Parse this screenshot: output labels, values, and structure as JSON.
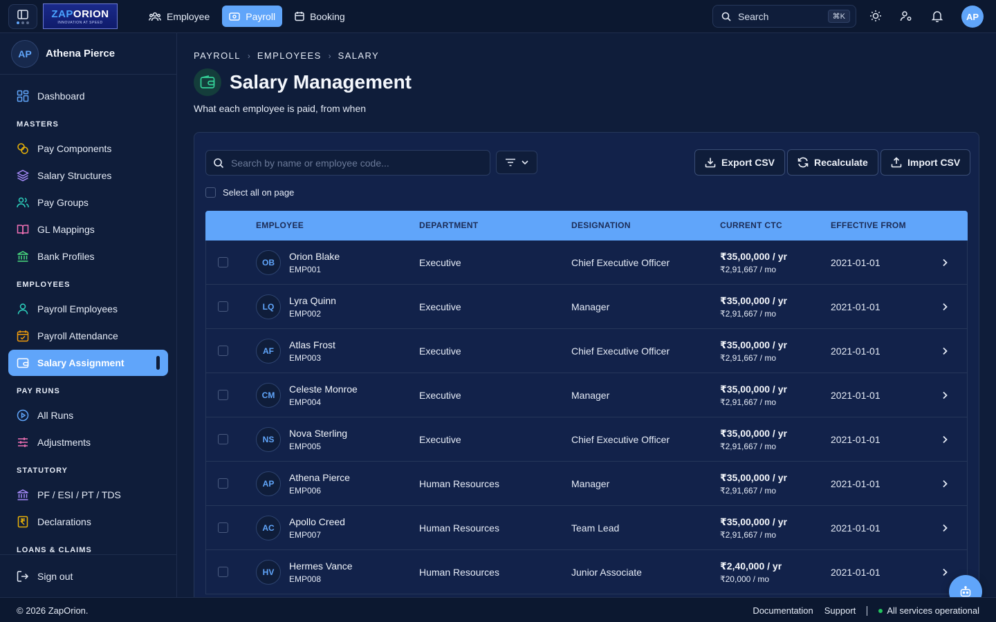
{
  "topbar": {
    "logo": {
      "name_a": "ZAP",
      "name_b": "ORION",
      "tagline": "INNOVATION AT SPEED"
    },
    "nav": [
      {
        "label": "Employee",
        "icon": "users-icon",
        "active": false
      },
      {
        "label": "Payroll",
        "icon": "wallet-icon",
        "active": true
      },
      {
        "label": "Booking",
        "icon": "calendar-icon",
        "active": false
      }
    ],
    "search": {
      "label": "Search",
      "shortcut": "⌘K"
    },
    "avatar_initials": "AP"
  },
  "sidebar": {
    "user": {
      "initials": "AP",
      "name": "Athena Pierce"
    },
    "items": {
      "dashboard": "Dashboard",
      "pay_components": "Pay Components",
      "salary_structures": "Salary Structures",
      "pay_groups": "Pay Groups",
      "gl_mappings": "GL Mappings",
      "bank_profiles": "Bank Profiles",
      "payroll_employees": "Payroll Employees",
      "payroll_attendance": "Payroll Attendance",
      "salary_assignment": "Salary Assignment",
      "all_runs": "All Runs",
      "adjustments": "Adjustments",
      "statutory_codes": "PF / ESI / PT / TDS",
      "declarations": "Declarations"
    },
    "sections": {
      "masters": "MASTERS",
      "employees": "EMPLOYEES",
      "pay_runs": "PAY RUNS",
      "statutory": "STATUTORY",
      "loans": "LOANS & CLAIMS"
    },
    "signout": "Sign out"
  },
  "breadcrumb": [
    "PAYROLL",
    "EMPLOYEES",
    "SALARY"
  ],
  "page": {
    "title": "Salary Management",
    "subtitle": "What each employee is paid, from when"
  },
  "toolbar": {
    "search_placeholder": "Search by name or employee code...",
    "export": "Export CSV",
    "recalculate": "Recalculate",
    "import": "Import CSV",
    "select_all": "Select all on page"
  },
  "table": {
    "columns": [
      "EMPLOYEE",
      "DEPARTMENT",
      "DESIGNATION",
      "CURRENT CTC",
      "EFFECTIVE FROM"
    ],
    "rows": [
      {
        "initials": "OB",
        "name": "Orion Blake",
        "code": "EMP001",
        "department": "Executive",
        "designation": "Chief Executive Officer",
        "ctc_year": "₹35,00,000 / yr",
        "ctc_month": "₹2,91,667 / mo",
        "effective": "2021-01-01"
      },
      {
        "initials": "LQ",
        "name": "Lyra Quinn",
        "code": "EMP002",
        "department": "Executive",
        "designation": "Manager",
        "ctc_year": "₹35,00,000 / yr",
        "ctc_month": "₹2,91,667 / mo",
        "effective": "2021-01-01"
      },
      {
        "initials": "AF",
        "name": "Atlas Frost",
        "code": "EMP003",
        "department": "Executive",
        "designation": "Chief Executive Officer",
        "ctc_year": "₹35,00,000 / yr",
        "ctc_month": "₹2,91,667 / mo",
        "effective": "2021-01-01"
      },
      {
        "initials": "CM",
        "name": "Celeste Monroe",
        "code": "EMP004",
        "department": "Executive",
        "designation": "Manager",
        "ctc_year": "₹35,00,000 / yr",
        "ctc_month": "₹2,91,667 / mo",
        "effective": "2021-01-01"
      },
      {
        "initials": "NS",
        "name": "Nova Sterling",
        "code": "EMP005",
        "department": "Executive",
        "designation": "Chief Executive Officer",
        "ctc_year": "₹35,00,000 / yr",
        "ctc_month": "₹2,91,667 / mo",
        "effective": "2021-01-01"
      },
      {
        "initials": "AP",
        "name": "Athena Pierce",
        "code": "EMP006",
        "department": "Human Resources",
        "designation": "Manager",
        "ctc_year": "₹35,00,000 / yr",
        "ctc_month": "₹2,91,667 / mo",
        "effective": "2021-01-01"
      },
      {
        "initials": "AC",
        "name": "Apollo Creed",
        "code": "EMP007",
        "department": "Human Resources",
        "designation": "Team Lead",
        "ctc_year": "₹35,00,000 / yr",
        "ctc_month": "₹2,91,667 / mo",
        "effective": "2021-01-01"
      },
      {
        "initials": "HV",
        "name": "Hermes Vance",
        "code": "EMP008",
        "department": "Human Resources",
        "designation": "Junior Associate",
        "ctc_year": "₹2,40,000 / yr",
        "ctc_month": "₹20,000 / mo",
        "effective": "2021-01-01"
      }
    ]
  },
  "footer": {
    "copyright": "© 2026 ZapOrion.",
    "documentation": "Documentation",
    "support": "Support",
    "status": "All services operational"
  },
  "colors": {
    "accent": "#60a5fa",
    "background": "#0f1d3a",
    "card": "#12224a",
    "status_ok": "#22c55e"
  }
}
